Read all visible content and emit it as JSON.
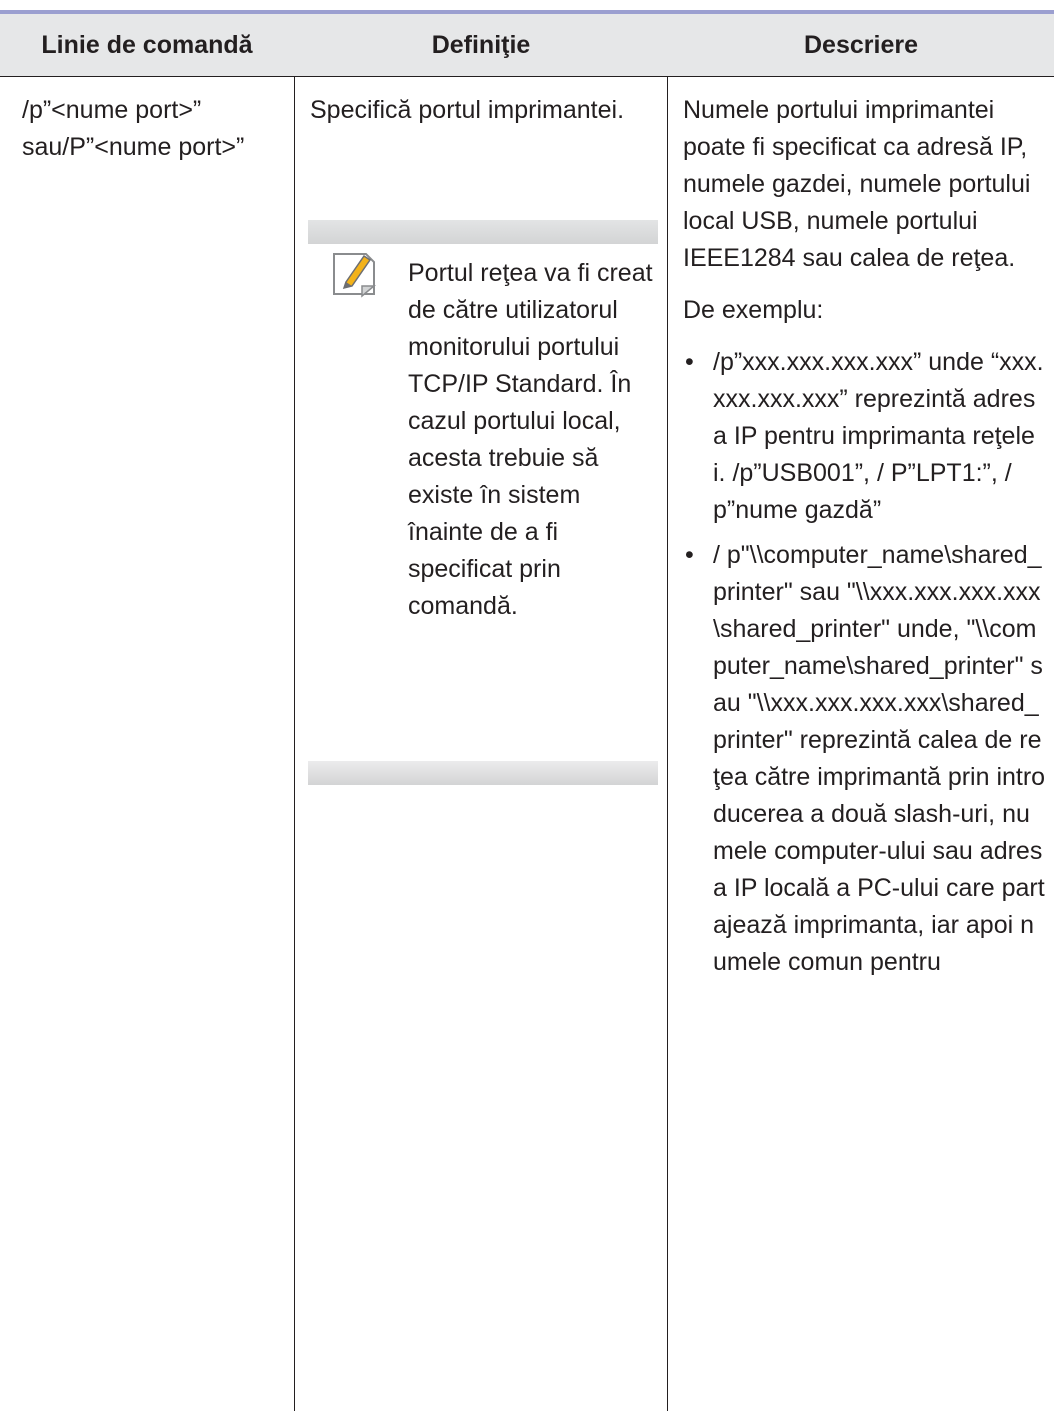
{
  "table": {
    "headers": [
      "Linie de comandă",
      "Definiţie",
      "Descriere"
    ],
    "row": {
      "command": "/p”<nume port>” sau/P”<nume port>”",
      "definition": "Specifică portul imprimantei.",
      "note": "Portul reţea va fi creat de către utilizatorul monitorului portului TCP/IP Standard. În cazul portului local, acesta trebuie să existe în sistem înainte de a fi specificat prin comandă.",
      "description_intro": "Numele portului imprimantei poate fi specificat ca adresă IP, numele gazdei, numele portului local USB, numele portului IEEE1284 sau calea de reţea.",
      "description_example_label": "De exemplu:",
      "bullets": [
        "/p”xxx.xxx.xxx.xxx” unde “xxx.xxx.xxx.xxx” reprezintă adresa IP pentru imprimanta reţelei. /p”USB001”, / P”LPT1:”, /p”nume gazdă”",
        "/ p\"\\\\computer_name\\shared_printer\" sau \"\\\\xxx.xxx.xxx.xxx\\shared_printer\" unde, \"\\\\computer_name\\shared_printer\" sau \"\\\\xxx.xxx.xxx.xxx\\shared_printer\" reprezintă calea de reţea către imprimantă prin introducerea a două slash-uri, numele computer-ului sau adresa IP locală a PC-ului care partajează imprimanta, iar apoi numele comun pentru"
      ]
    }
  },
  "icons": {
    "note": "note-pencil-icon"
  },
  "colors": {
    "top_rule": "#9b9fd0",
    "header_bg": "#e6e7e8",
    "text": "#231f20",
    "icon_accent": "#f3b21a"
  }
}
